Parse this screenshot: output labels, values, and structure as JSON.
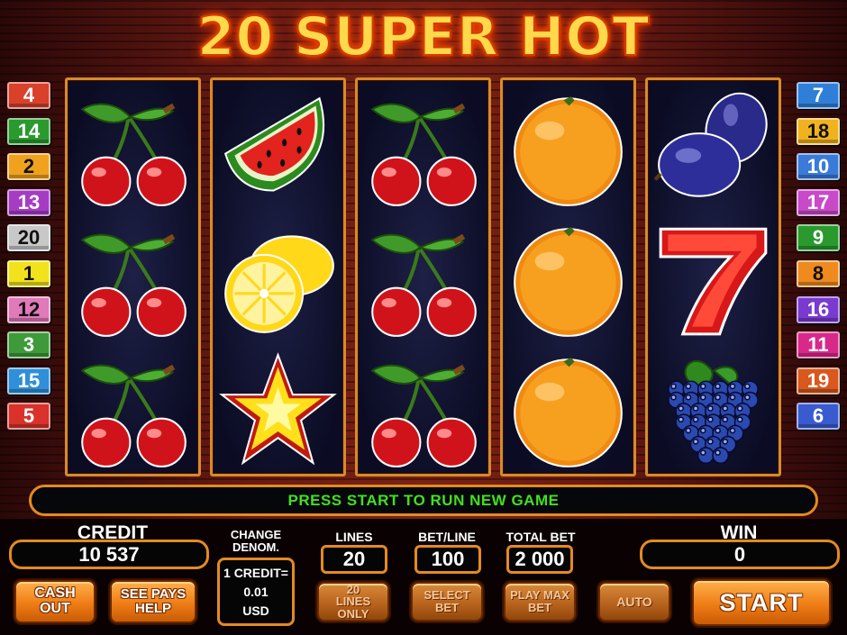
{
  "title": "20 SUPER HOT",
  "left_line_tags": [
    {
      "label": "4",
      "color": "#d9412b"
    },
    {
      "label": "14",
      "color": "#2a9a2e"
    },
    {
      "label": "2",
      "color": "#f0a21e"
    },
    {
      "label": "13",
      "color": "#a63cc4"
    },
    {
      "label": "20",
      "color": "#c8c8c8"
    },
    {
      "label": "1",
      "color": "#f2e21e"
    },
    {
      "label": "12",
      "color": "#e07ab8"
    },
    {
      "label": "3",
      "color": "#3f9a3a"
    },
    {
      "label": "15",
      "color": "#2f8fd8"
    },
    {
      "label": "5",
      "color": "#d8322a"
    }
  ],
  "right_line_tags": [
    {
      "label": "7",
      "color": "#2f7fd8"
    },
    {
      "label": "18",
      "color": "#f0b21e"
    },
    {
      "label": "10",
      "color": "#3a7ad8"
    },
    {
      "label": "17",
      "color": "#c84ac8"
    },
    {
      "label": "9",
      "color": "#2a9a2e"
    },
    {
      "label": "8",
      "color": "#ef8a1e"
    },
    {
      "label": "16",
      "color": "#7a3ad0"
    },
    {
      "label": "11",
      "color": "#d8288a"
    },
    {
      "label": "19",
      "color": "#d8581e"
    },
    {
      "label": "6",
      "color": "#3a5ad0"
    }
  ],
  "reels": [
    [
      "cherries",
      "cherries",
      "cherries"
    ],
    [
      "watermelon",
      "lemon",
      "star"
    ],
    [
      "cherries",
      "cherries",
      "cherries"
    ],
    [
      "orange",
      "orange",
      "orange"
    ],
    [
      "plums",
      "seven",
      "grapes"
    ]
  ],
  "message": "PRESS START TO RUN NEW GAME",
  "credit": {
    "label": "CREDIT",
    "value": "10 537"
  },
  "denomination": {
    "label": "CHANGE DENOM.",
    "line1": "1 CREDIT=",
    "line2": "0.01",
    "line3": "USD"
  },
  "lines": {
    "label": "LINES",
    "value": "20"
  },
  "bet_line": {
    "label": "BET/LINE",
    "value": "100"
  },
  "total_bet": {
    "label": "TOTAL BET",
    "value": "2 000"
  },
  "win": {
    "label": "WIN",
    "value": "0"
  },
  "buttons": {
    "cash_out": "CASH OUT",
    "see_pays": "SEE PAYS HELP",
    "lines_only": "20 LINES ONLY",
    "select_bet": "SELECT BET",
    "play_max": "PLAY MAX BET",
    "auto": "AUTO",
    "start": "START"
  }
}
